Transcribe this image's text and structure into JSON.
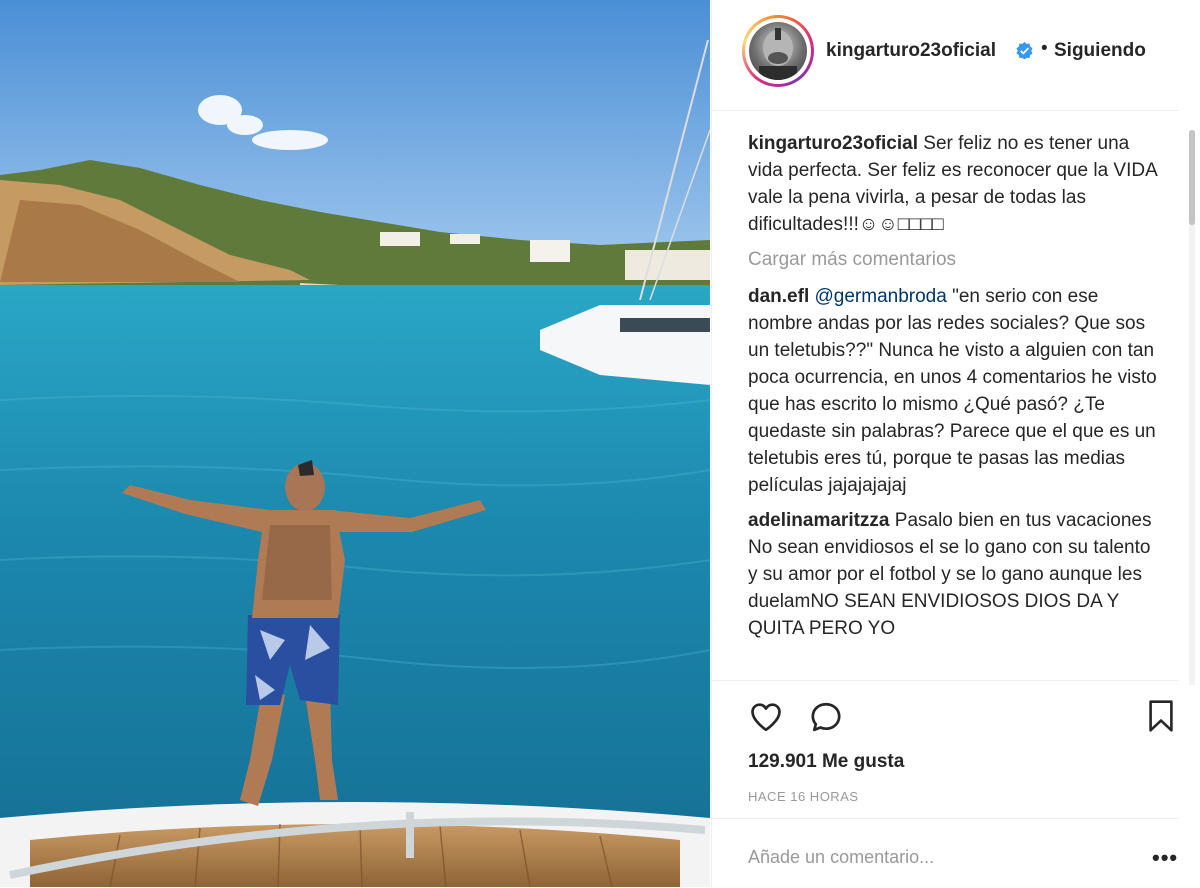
{
  "post": {
    "photo_alt": "",
    "author": "kingarturo23oficial",
    "verified_icon": "verified-badge-icon",
    "separator": "•",
    "follow_status": "Siguiendo"
  },
  "caption": {
    "user": "kingarturo23oficial",
    "text": "Ser feliz no es tener una vida perfecta. Ser feliz es reconocer que la VIDA vale la pena vivirla, a pesar de todas las dificultades!!!☺☺□□□□"
  },
  "load_more": "Cargar más comentarios",
  "comments": [
    {
      "user": "dan.efl",
      "mention": "@germanbroda",
      "text": "\"en serio con ese nombre andas por las redes sociales? Que sos un teletubis??\" Nunca he visto a alguien con tan poca ocurrencia, en unos 4 comentarios he visto que has escrito lo mismo ¿Qué pasó? ¿Te quedaste sin palabras? Parece que el que es un teletubis eres tú, porque te pasas las medias películas jajajajajaj"
    },
    {
      "user": "adelinamaritzza",
      "text": "Pasalo bien en tus vacaciones No sean envidiosos el se lo gano con su talento y su amor por el fotbol y se lo gano aunque les duelamNO SEAN ENVIDIOSOS DIOS DA Y QUITA PERO YO"
    }
  ],
  "actions": {
    "like_icon": "heart-icon",
    "comment_icon": "comment-bubble-icon",
    "save_icon": "bookmark-icon"
  },
  "likes": "129.901 Me gusta",
  "timestamp": "HACE 16 HORAS",
  "add_comment": {
    "placeholder": "Añade un comentario...",
    "more_label": "•••"
  },
  "colors": {
    "verified": "#3897f0",
    "muted": "#999999",
    "text": "#262626",
    "mention": "#003569"
  }
}
